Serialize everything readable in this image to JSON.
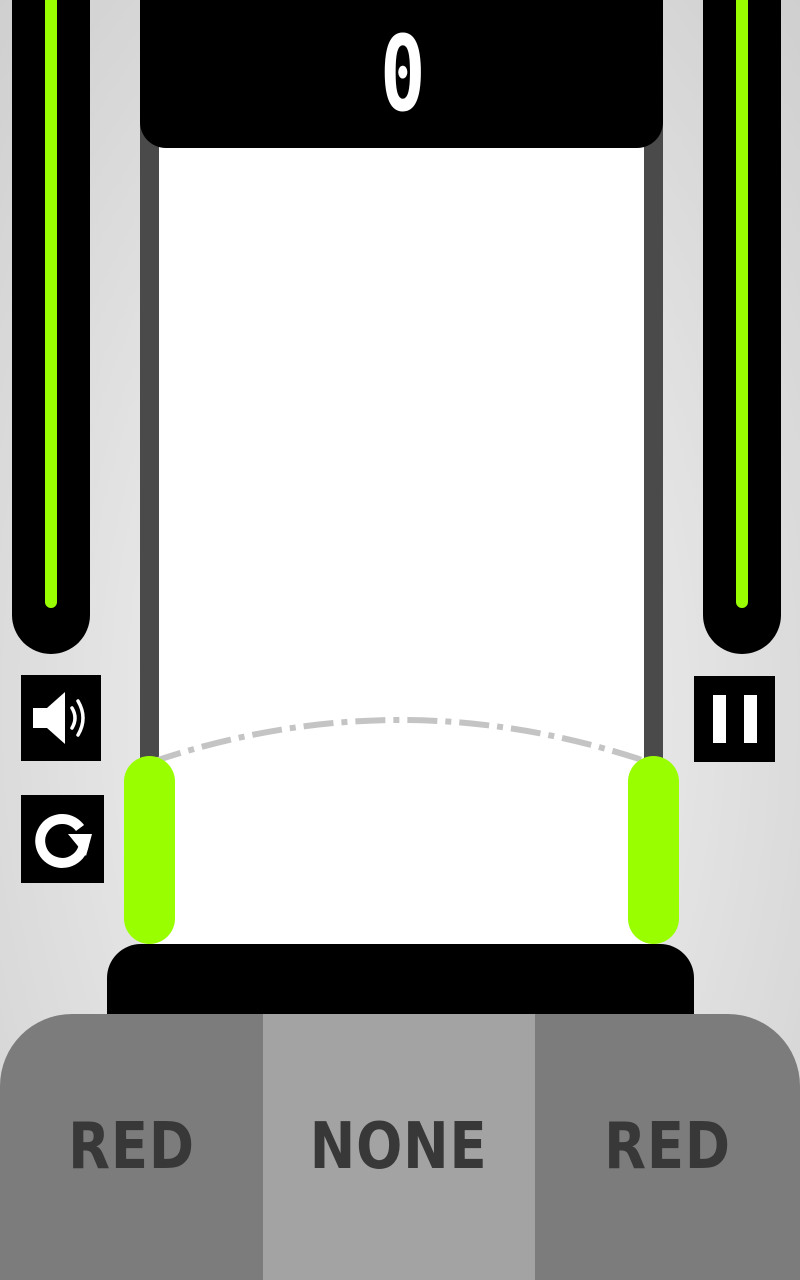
{
  "theme": {
    "accent_green": "#99ff00",
    "rail_gray": "#4a4a4a",
    "panel_black": "#000000",
    "selector_side": "#7c7c7c",
    "selector_center": "#a3a3a3",
    "label_color": "#383838"
  },
  "score": {
    "value": "0"
  },
  "meters": {
    "left_level": 0.95,
    "right_level": 0.95
  },
  "controls": {
    "sound_icon": "speaker-icon",
    "restart_icon": "restart-icon",
    "pause_icon": "pause-icon"
  },
  "selector": {
    "segments": [
      {
        "label": "RED"
      },
      {
        "label": "NONE"
      },
      {
        "label": "RED"
      }
    ]
  }
}
